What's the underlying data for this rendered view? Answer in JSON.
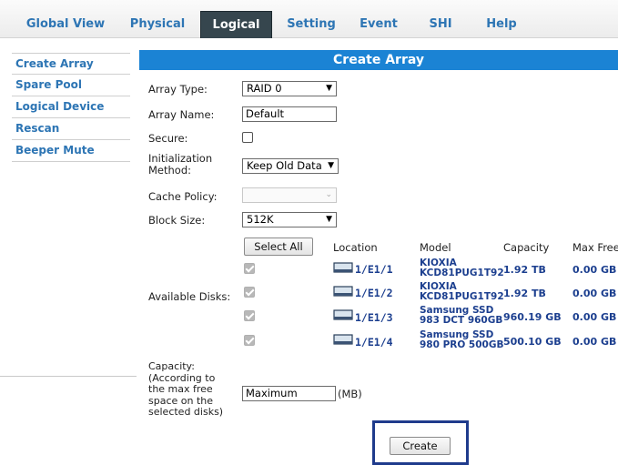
{
  "tabs": [
    {
      "label": "Global View",
      "active": false
    },
    {
      "label": "Physical",
      "active": false
    },
    {
      "label": "Logical",
      "active": true
    },
    {
      "label": "Setting",
      "active": false
    },
    {
      "label": "Event",
      "active": false
    },
    {
      "label": "SHI",
      "active": false
    },
    {
      "label": "Help",
      "active": false
    }
  ],
  "sidebar": {
    "items": [
      {
        "label": "Create Array"
      },
      {
        "label": "Spare Pool"
      },
      {
        "label": "Logical Device"
      },
      {
        "label": "Rescan"
      },
      {
        "label": "Beeper Mute"
      }
    ]
  },
  "form": {
    "title": "Create Array",
    "array_type": {
      "label": "Array Type:",
      "value": "RAID 0"
    },
    "array_name": {
      "label": "Array Name:",
      "value": "Default"
    },
    "secure": {
      "label": "Secure:",
      "checked": false
    },
    "init_method": {
      "label_line1": "Initialization",
      "label_line2": "Method:",
      "value": "Keep Old Data"
    },
    "cache_policy": {
      "label": "Cache Policy:",
      "value": "",
      "disabled": true
    },
    "block_size": {
      "label": "Block Size:",
      "value": "512K"
    },
    "available_disks_label": "Available Disks:",
    "select_all_label": "Select All",
    "columns": {
      "location": "Location",
      "model": "Model",
      "capacity": "Capacity",
      "max_free": "Max Free"
    },
    "disks": [
      {
        "checked": true,
        "location": "1/E1/1",
        "model_line1": "KIOXIA",
        "model_line2": "KCD81PUG1T92",
        "capacity": "1.92 TB",
        "max_free": "0.00 GB"
      },
      {
        "checked": true,
        "location": "1/E1/2",
        "model_line1": "KIOXIA",
        "model_line2": "KCD81PUG1T92",
        "capacity": "1.92 TB",
        "max_free": "0.00 GB"
      },
      {
        "checked": true,
        "location": "1/E1/3",
        "model_line1": "Samsung SSD",
        "model_line2": "983 DCT 960GB",
        "capacity": "960.19 GB",
        "max_free": "0.00 GB"
      },
      {
        "checked": true,
        "location": "1/E1/4",
        "model_line1": "Samsung SSD",
        "model_line2": "980 PRO 500GB",
        "capacity": "500.10 GB",
        "max_free": "0.00 GB"
      }
    ],
    "capacity": {
      "label_lines": [
        "Capacity:",
        "(According to",
        "the max free",
        "space on the",
        "selected disks)"
      ],
      "value": "Maximum",
      "unit": "(MB)"
    },
    "create_label": "Create"
  },
  "colors": {
    "header_blue": "#1b83d4",
    "tab_active_bg": "#36464e",
    "link_blue": "#2d75b4",
    "disk_text": "#1c3f8f",
    "highlight_frame": "#1f3b8c"
  }
}
